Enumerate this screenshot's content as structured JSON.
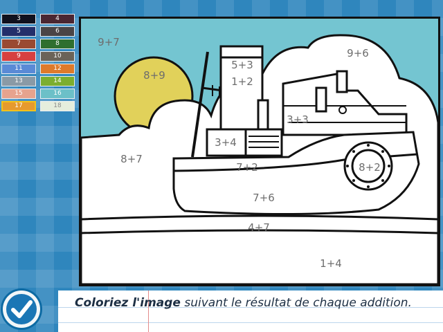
{
  "palette": [
    {
      "label": "3",
      "color": "#10111e"
    },
    {
      "label": "4",
      "color": "#4a2632"
    },
    {
      "label": "5",
      "color": "#232f6b"
    },
    {
      "label": "6",
      "color": "#4a4446"
    },
    {
      "label": "7",
      "color": "#9a4a32"
    },
    {
      "label": "8",
      "color": "#2f6f2f"
    },
    {
      "label": "9",
      "color": "#d64040"
    },
    {
      "label": "10",
      "color": "#6b6358"
    },
    {
      "label": "11",
      "color": "#5a8ad6"
    },
    {
      "label": "12",
      "color": "#de7a2b"
    },
    {
      "label": "13",
      "color": "#8a9aa6"
    },
    {
      "label": "14",
      "color": "#7cae2f"
    },
    {
      "label": "15",
      "color": "#e6a38e"
    },
    {
      "label": "16",
      "color": "#6cc0c8"
    },
    {
      "label": "17",
      "color": "#e69a2e"
    },
    {
      "label": "18",
      "color": "#e6eedd"
    }
  ],
  "selected_color": "17",
  "regions": {
    "sky_top_left": "9+7",
    "sky_right": "9+6",
    "sun": "8+9",
    "chimney_top": "5+3",
    "chimney_mid": "1+2",
    "cabin_window": "3+3",
    "box": "3+4",
    "cloud_left": "8+7",
    "hull_band": "7+2",
    "porthole": "8+2",
    "hull_lower": "7+6",
    "water": "4+7",
    "ground": "1+4"
  },
  "instruction": {
    "bold": "Coloriez l'image",
    "rest": " suivant le résultat de chaque addition."
  },
  "colors": {
    "sky": "#74c5d1",
    "sun": "#e1d15a",
    "background": "#2f86bd"
  }
}
